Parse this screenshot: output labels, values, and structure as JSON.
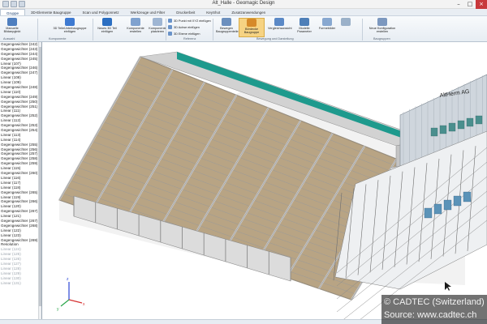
{
  "window": {
    "title": "Alt_Halle - Geomagic Design"
  },
  "menu": {
    "tabs": [
      "Gruppe",
      "3D-Elemente Baugruppe",
      "Scan und Polygonnetz",
      "Werkzeuge und Filter",
      "Druckerbeit",
      "KeyShot",
      "Zusatzanwendungen"
    ]
  },
  "ribbon": {
    "buttons": {
      "manual_select": "Manuelle Bildanpglnkt",
      "transform": "3D TeileUnterbaugruppe einfügen",
      "new_part": "Neues 3D Teil einfügen",
      "component": "Komponente erstellen",
      "place_comp": "Komponente platzieren",
      "move": "Bewegen Baugruppenteile",
      "section": "Bördecke Baugruppe",
      "explode": "Vergleichsansicht",
      "animate": "Modelle Parameter",
      "schema": "Formebilder",
      "new_config": "Neue Konfiguration erstellen"
    },
    "small": {
      "p1": "3D Punkt mit XYZ einfügen",
      "p2": "3D Achse einfügen",
      "p3": "3D Ebene einfügen"
    },
    "groups": [
      "Auswahl",
      "Komponente",
      "Referenz",
      "Bewegung und Darstellung",
      "Baugruppen"
    ]
  },
  "sidebar": {
    "items": [
      "Gegengewichter (242)",
      "Gegengewichter (243)",
      "Gegengewichter (244)",
      "Gegengewichter (245)",
      "Linear (107)",
      "Gegengewichter (246)",
      "Gegengewichter (247)",
      "Linear (108)",
      "Linear (109)",
      "Gegengewichter (248)",
      "Linear (110)",
      "Gegengewichter (249)",
      "Gegengewichter (250)",
      "Gegengewichter (251)",
      "Linear (111)",
      "Gegengewichter (252)",
      "Linear (112)",
      "Gegengewichter (253)",
      "Gegengewichter (254)",
      "Linear (113)",
      "Linear (114)",
      "Gegengewichter (255)",
      "Gegengewichter (256)",
      "Gegengewichter (257)",
      "Gegengewichter (258)",
      "Gegengewichter (259)",
      "Linear (115)",
      "Gegengewichter (260)",
      "Linear (116)",
      "Linear (117)",
      "Linear (118)",
      "Gegengewichter (265)",
      "Linear (119)",
      "Gegengewichter (266)",
      "Linear (120)",
      "Gegengewichter (267)",
      "Linear (121)",
      "Gegengewichter (267)",
      "Gegengewichter (268)",
      "Linear (122)",
      "Linear (123)",
      "Gegengewichter (269)",
      "Resolution",
      "Linear (124)",
      "Linear (125)",
      "Linear (126)",
      "Linear (127)",
      "Linear (128)",
      "Linear (129)",
      "Linear (130)",
      "Linear (131)"
    ]
  },
  "model": {
    "sign_text": "AltHerm AG",
    "colors": {
      "roof_band": "#1e9a8d",
      "beam": "#c8c8c8",
      "wood": "#b8a484",
      "orange": "#d9a35f"
    }
  },
  "watermark": {
    "line1": "© CADTEC (Switzerland) G",
    "line2": "Source: www.cadtec.ch"
  }
}
